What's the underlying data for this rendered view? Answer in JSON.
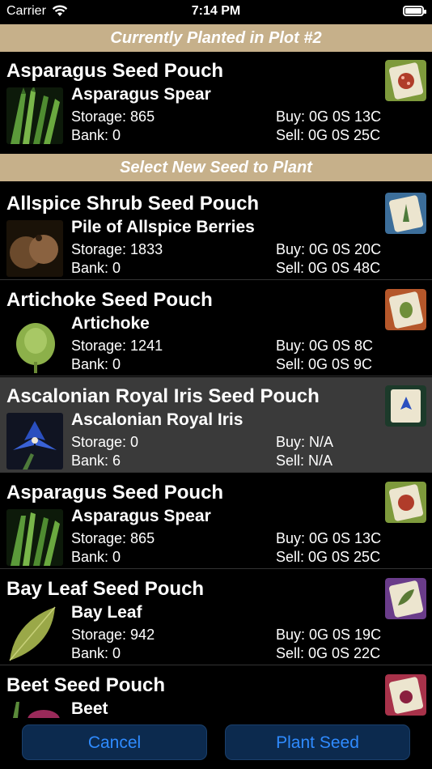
{
  "status_bar": {
    "carrier": "Carrier",
    "time": "7:14 PM"
  },
  "current_header": "Currently Planted in Plot #2",
  "select_header": "Select New Seed to Plant",
  "current": {
    "pouch": "Asparagus Seed Pouch",
    "item": "Asparagus Spear",
    "storage": "Storage: 865",
    "bank": "Bank: 0",
    "buy": "Buy: 0G 0S 13C",
    "sell": "Sell: 0G 0S 25C"
  },
  "seeds": [
    {
      "pouch": "Allspice Shrub Seed Pouch",
      "item": "Pile of Allspice Berries",
      "storage": "Storage: 1833",
      "bank": "Bank: 0",
      "buy": "Buy: 0G 0S 20C",
      "sell": "Sell: 0G 0S 48C"
    },
    {
      "pouch": "Artichoke Seed Pouch",
      "item": "Artichoke",
      "storage": "Storage: 1241",
      "bank": "Bank: 0",
      "buy": "Buy: 0G 0S 8C",
      "sell": "Sell: 0G 0S 9C"
    },
    {
      "pouch": "Ascalonian Royal Iris Seed Pouch",
      "item": "Ascalonian Royal Iris",
      "storage": "Storage: 0",
      "bank": "Bank: 6",
      "buy": "Buy: N/A",
      "sell": "Sell: N/A"
    },
    {
      "pouch": "Asparagus Seed Pouch",
      "item": "Asparagus Spear",
      "storage": "Storage: 865",
      "bank": "Bank: 0",
      "buy": "Buy: 0G 0S 13C",
      "sell": "Sell: 0G 0S 25C"
    },
    {
      "pouch": "Bay Leaf Seed Pouch",
      "item": "Bay Leaf",
      "storage": "Storage: 942",
      "bank": "Bank: 0",
      "buy": "Buy: 0G 0S 19C",
      "sell": "Sell: 0G 0S 22C"
    },
    {
      "pouch": "Beet Seed Pouch",
      "item": "Beet"
    }
  ],
  "buttons": {
    "cancel": "Cancel",
    "plant": "Plant Seed"
  },
  "colors": {
    "header_bg": "#c6b08a",
    "selected_row": "#3a3a3a",
    "button_bg": "#0c2a4e",
    "button_text": "#2f8bff"
  }
}
